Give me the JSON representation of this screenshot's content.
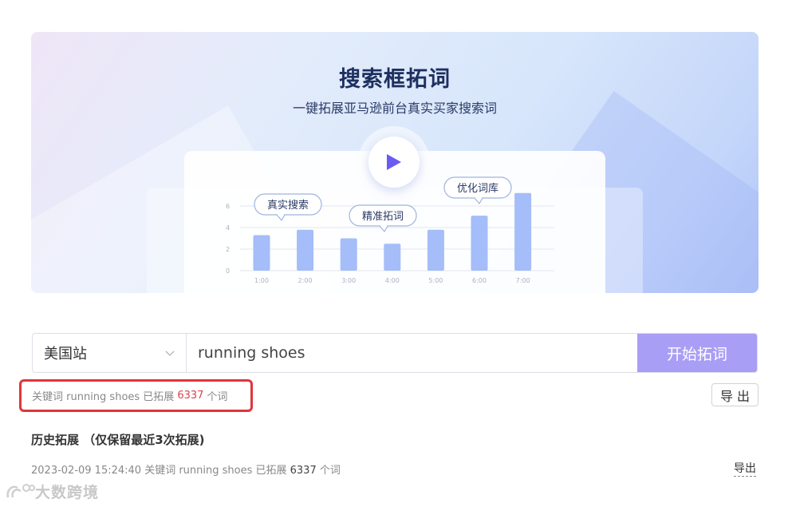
{
  "banner": {
    "title": "搜索框拓词",
    "subtitle": "一键拓展亚马逊前台真实买家搜索词",
    "bubbles": [
      "真实搜索",
      "精准拓词",
      "优化词库"
    ]
  },
  "chart_data": {
    "type": "bar",
    "categories": [
      "1:00",
      "2:00",
      "3:00",
      "4:00",
      "5:00",
      "6:00",
      "7:00"
    ],
    "values": [
      3.3,
      3.8,
      3.0,
      2.5,
      3.8,
      5.1,
      7.2
    ],
    "yticks": [
      "0",
      "2",
      "4",
      "6"
    ],
    "ylim": [
      0,
      7.5
    ],
    "title": "",
    "xlabel": "",
    "ylabel": ""
  },
  "search": {
    "site": "美国站",
    "keyword": "running shoes",
    "start_label": "开始拓词"
  },
  "result": {
    "prefix": "关键词 running shoes 已拓展",
    "count": "6337",
    "suffix": "个词",
    "export_label": "导 出"
  },
  "history": {
    "title": "历史拓展 （仅保留最近3次拓展)",
    "items": [
      {
        "text": "2023-02-09 15:24:40 关键词 running shoes 已拓展 ",
        "count": "6337",
        "suffix": " 个词",
        "export_label": "导出"
      }
    ]
  },
  "watermark": {
    "text": "大数跨境"
  },
  "colors": {
    "accent": "#a99ef6",
    "highlight": "#e0353a",
    "bar": "#a5bdf8"
  }
}
